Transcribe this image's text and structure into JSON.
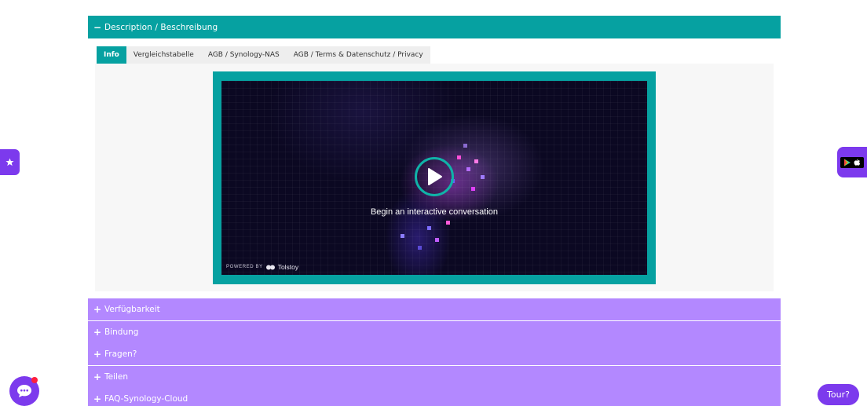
{
  "accordion_open": {
    "sign": "−",
    "label": "Description / Beschreibung"
  },
  "tabs": [
    {
      "label": "Info"
    },
    {
      "label": "Vergleichstabelle"
    },
    {
      "label": "AGB / Synology-NAS"
    },
    {
      "label": "AGB / Terms & Datenschutz / Privacy"
    }
  ],
  "video": {
    "caption": "Begin an interactive conversation",
    "powered_label": "POWERED BY",
    "brand": "Tolstoy",
    "play_icon": "play-icon"
  },
  "accordion_closed": [
    {
      "sign": "+",
      "label": "Verfügbarkeit"
    },
    {
      "sign": "+",
      "label": "Bindung"
    },
    {
      "sign": "+",
      "label": "Fragen?"
    },
    {
      "sign": "+",
      "label": "Teilen"
    },
    {
      "sign": "+",
      "label": "FAQ-Synology-Cloud"
    }
  ],
  "widgets": {
    "tour_label": "Tour?",
    "left_icon": "star-icon",
    "right_icon": "app-store-badge-icon",
    "chat_icon": "chat-bubble-icon"
  },
  "colors": {
    "teal": "#06a1a1",
    "lavender": "#b388ff",
    "purple": "#7c3aed",
    "notification_red": "#ff1f3d"
  }
}
